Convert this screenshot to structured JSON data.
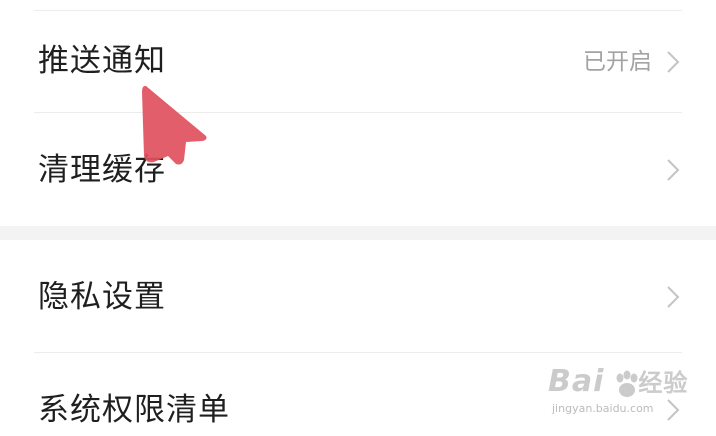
{
  "settings": {
    "group1": [
      {
        "label": "推送通知",
        "value": "已开启"
      },
      {
        "label": "清理缓存",
        "value": ""
      }
    ],
    "group2": [
      {
        "label": "隐私设置",
        "value": ""
      },
      {
        "label": "系统权限清单",
        "value": ""
      }
    ]
  },
  "overlay": {
    "pointer_color": "#e0505e",
    "watermark_brand": "Bai 经验",
    "watermark_url": "jingyan.baidu.com"
  }
}
